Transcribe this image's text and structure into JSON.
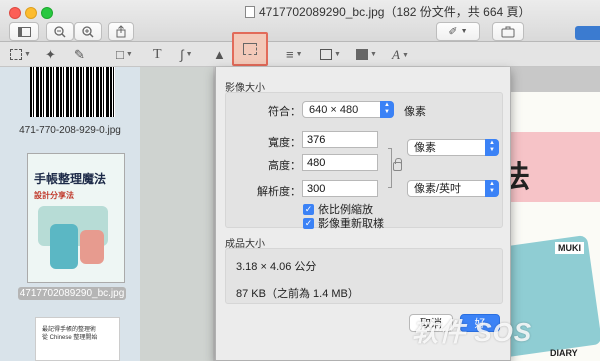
{
  "window": {
    "title": "4717702089290_bc.jpg（182 份文件，共 664 頁）"
  },
  "sidebar": {
    "thumb1_label": "471-770-208-929-0.jpg",
    "thumb2_label": "4717702089290_bc.jpg",
    "book_title_line1": "手帳整理魔法",
    "book_title_line2": "設計分享法",
    "book2_line1": "最記得手帳的整理術",
    "book2_line2": "從 Chinese 整理開始"
  },
  "document": {
    "page_text_1": "法",
    "page_text_2": "MUKI",
    "page_text_3": "DIARY"
  },
  "sheet": {
    "image_size_section": "影像大小",
    "fit_label": "符合：",
    "fit_value": "640 × 480",
    "fit_unit": "像素",
    "width_label": "寬度：",
    "width_value": "376",
    "height_label": "高度：",
    "height_value": "480",
    "size_unit": "像素",
    "resolution_label": "解析度：",
    "resolution_value": "300",
    "resolution_unit": "像素/英吋",
    "scale_proportionally": "依比例縮放",
    "resample_image": "影像重新取樣",
    "result_section": "成品大小",
    "result_dimensions": "3.18 × 4.06 公分",
    "result_filesize": "87 KB（之前為 1.4 MB）",
    "cancel_label": "取消",
    "ok_label": "好"
  },
  "watermark": "软件 SOS",
  "colors": {
    "accent": "#3b82f6",
    "crop_highlight_border": "#e26b5a",
    "crop_highlight_fill": "#f3c9b9"
  },
  "icons": {
    "toolbar": [
      "zoom-out-icon",
      "zoom-in-icon",
      "share-icon",
      "pen-icon",
      "toolbox-icon"
    ],
    "markup": [
      "selection-icon",
      "magic-wand-icon",
      "sketch-icon",
      "shapes-icon",
      "text-icon",
      "sign-icon",
      "adjust-color-icon",
      "crop-icon",
      "line-style-icon",
      "border-color-icon",
      "fill-color-icon",
      "text-style-icon"
    ]
  }
}
